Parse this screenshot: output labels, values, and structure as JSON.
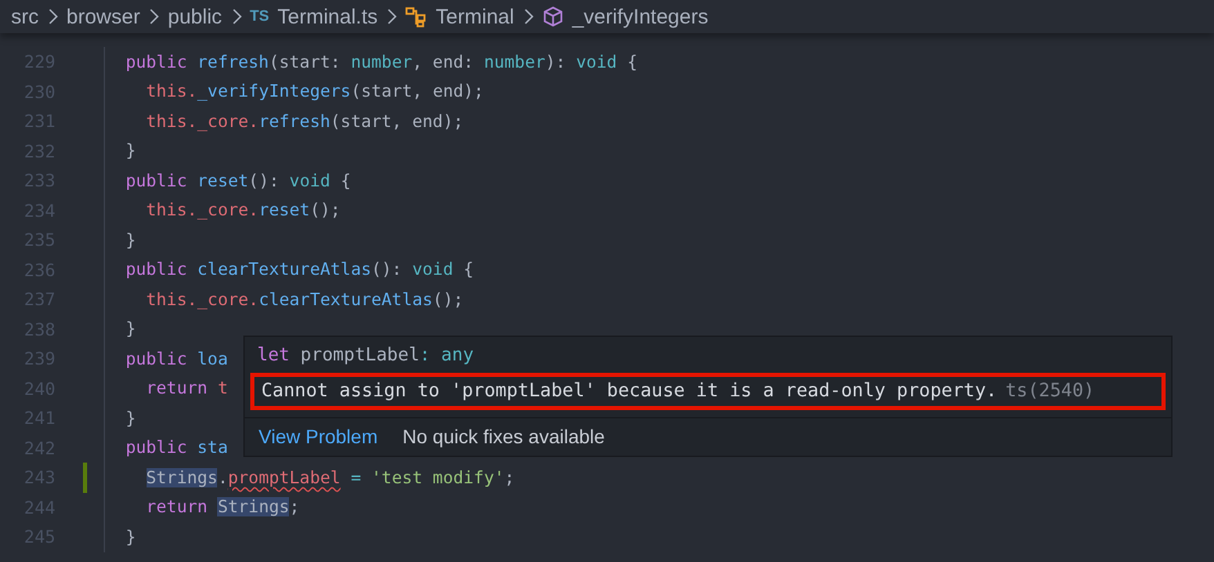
{
  "breadcrumbs": [
    {
      "label": "src",
      "kind": "folder"
    },
    {
      "label": "browser",
      "kind": "folder"
    },
    {
      "label": "public",
      "kind": "folder"
    },
    {
      "label": "Terminal.ts",
      "kind": "ts-file",
      "badge": "TS"
    },
    {
      "label": "Terminal",
      "kind": "class"
    },
    {
      "label": "_verifyIntegers",
      "kind": "method"
    }
  ],
  "lines": [
    {
      "number": "229",
      "modified": false,
      "tokens": [
        {
          "kind": "keyword",
          "text": "  public "
        },
        {
          "kind": "function",
          "text": "refresh"
        },
        {
          "kind": "plain",
          "text": "(start: "
        },
        {
          "kind": "type",
          "text": "number"
        },
        {
          "kind": "plain",
          "text": ", end: "
        },
        {
          "kind": "type",
          "text": "number"
        },
        {
          "kind": "plain",
          "text": "): "
        },
        {
          "kind": "type",
          "text": "void"
        },
        {
          "kind": "plain",
          "text": " {"
        }
      ]
    },
    {
      "number": "230",
      "modified": false,
      "tokens": [
        {
          "kind": "variable",
          "text": "    this."
        },
        {
          "kind": "function",
          "text": "_verifyIntegers"
        },
        {
          "kind": "plain",
          "text": "(start, end);"
        }
      ]
    },
    {
      "number": "231",
      "modified": false,
      "tokens": [
        {
          "kind": "variable",
          "text": "    this._core."
        },
        {
          "kind": "function",
          "text": "refresh"
        },
        {
          "kind": "plain",
          "text": "(start, end);"
        }
      ]
    },
    {
      "number": "232",
      "modified": false,
      "tokens": [
        {
          "kind": "plain",
          "text": "  }"
        }
      ]
    },
    {
      "number": "233",
      "modified": false,
      "tokens": [
        {
          "kind": "keyword",
          "text": "  public "
        },
        {
          "kind": "function",
          "text": "reset"
        },
        {
          "kind": "plain",
          "text": "(): "
        },
        {
          "kind": "type",
          "text": "void"
        },
        {
          "kind": "plain",
          "text": " {"
        }
      ]
    },
    {
      "number": "234",
      "modified": false,
      "tokens": [
        {
          "kind": "variable",
          "text": "    this._core."
        },
        {
          "kind": "function",
          "text": "reset"
        },
        {
          "kind": "plain",
          "text": "();"
        }
      ]
    },
    {
      "number": "235",
      "modified": false,
      "tokens": [
        {
          "kind": "plain",
          "text": "  }"
        }
      ]
    },
    {
      "number": "236",
      "modified": false,
      "tokens": [
        {
          "kind": "keyword",
          "text": "  public "
        },
        {
          "kind": "function",
          "text": "clearTextureAtlas"
        },
        {
          "kind": "plain",
          "text": "(): "
        },
        {
          "kind": "type",
          "text": "void"
        },
        {
          "kind": "plain",
          "text": " {"
        }
      ]
    },
    {
      "number": "237",
      "modified": false,
      "tokens": [
        {
          "kind": "variable",
          "text": "    this._core."
        },
        {
          "kind": "function",
          "text": "clearTextureAtlas"
        },
        {
          "kind": "plain",
          "text": "();"
        }
      ]
    },
    {
      "number": "238",
      "modified": false,
      "tokens": [
        {
          "kind": "plain",
          "text": "  }"
        }
      ]
    },
    {
      "number": "239",
      "modified": false,
      "tokens": [
        {
          "kind": "keyword",
          "text": "  public "
        },
        {
          "kind": "function",
          "text": "loa"
        }
      ]
    },
    {
      "number": "240",
      "modified": false,
      "tokens": [
        {
          "kind": "keyword",
          "text": "    return "
        },
        {
          "kind": "variable",
          "text": "t"
        }
      ]
    },
    {
      "number": "241",
      "modified": false,
      "tokens": [
        {
          "kind": "plain",
          "text": "  }"
        }
      ]
    },
    {
      "number": "242",
      "modified": false,
      "tokens": [
        {
          "kind": "keyword",
          "text": "  public "
        },
        {
          "kind": "function",
          "text": "sta"
        }
      ]
    },
    {
      "number": "243",
      "modified": true,
      "tokens": [
        {
          "kind": "plain",
          "text": "    Strings",
          "highlight": true
        },
        {
          "kind": "plain",
          "text": "."
        },
        {
          "kind": "variable",
          "text": "promptLabel",
          "error": true
        },
        {
          "kind": "type",
          "text": " = "
        },
        {
          "kind": "string",
          "text": "'test modify'"
        },
        {
          "kind": "plain",
          "text": ";"
        }
      ]
    },
    {
      "number": "244",
      "modified": false,
      "tokens": [
        {
          "kind": "keyword",
          "text": "    return "
        },
        {
          "kind": "plain",
          "text": "Strings",
          "highlight": true
        },
        {
          "kind": "plain",
          "text": ";"
        }
      ]
    },
    {
      "number": "245",
      "modified": false,
      "tokens": [
        {
          "kind": "plain",
          "text": "  }"
        }
      ]
    }
  ],
  "hover": {
    "signature": [
      {
        "kind": "keyword",
        "text": "let"
      },
      {
        "kind": "plain",
        "text": " promptLabel"
      },
      {
        "kind": "type",
        "text": ": any"
      }
    ],
    "message": "Cannot assign to 'promptLabel' because it is a read-only property.",
    "code": "ts(2540)",
    "action": "View Problem",
    "status": "No quick fixes available"
  }
}
